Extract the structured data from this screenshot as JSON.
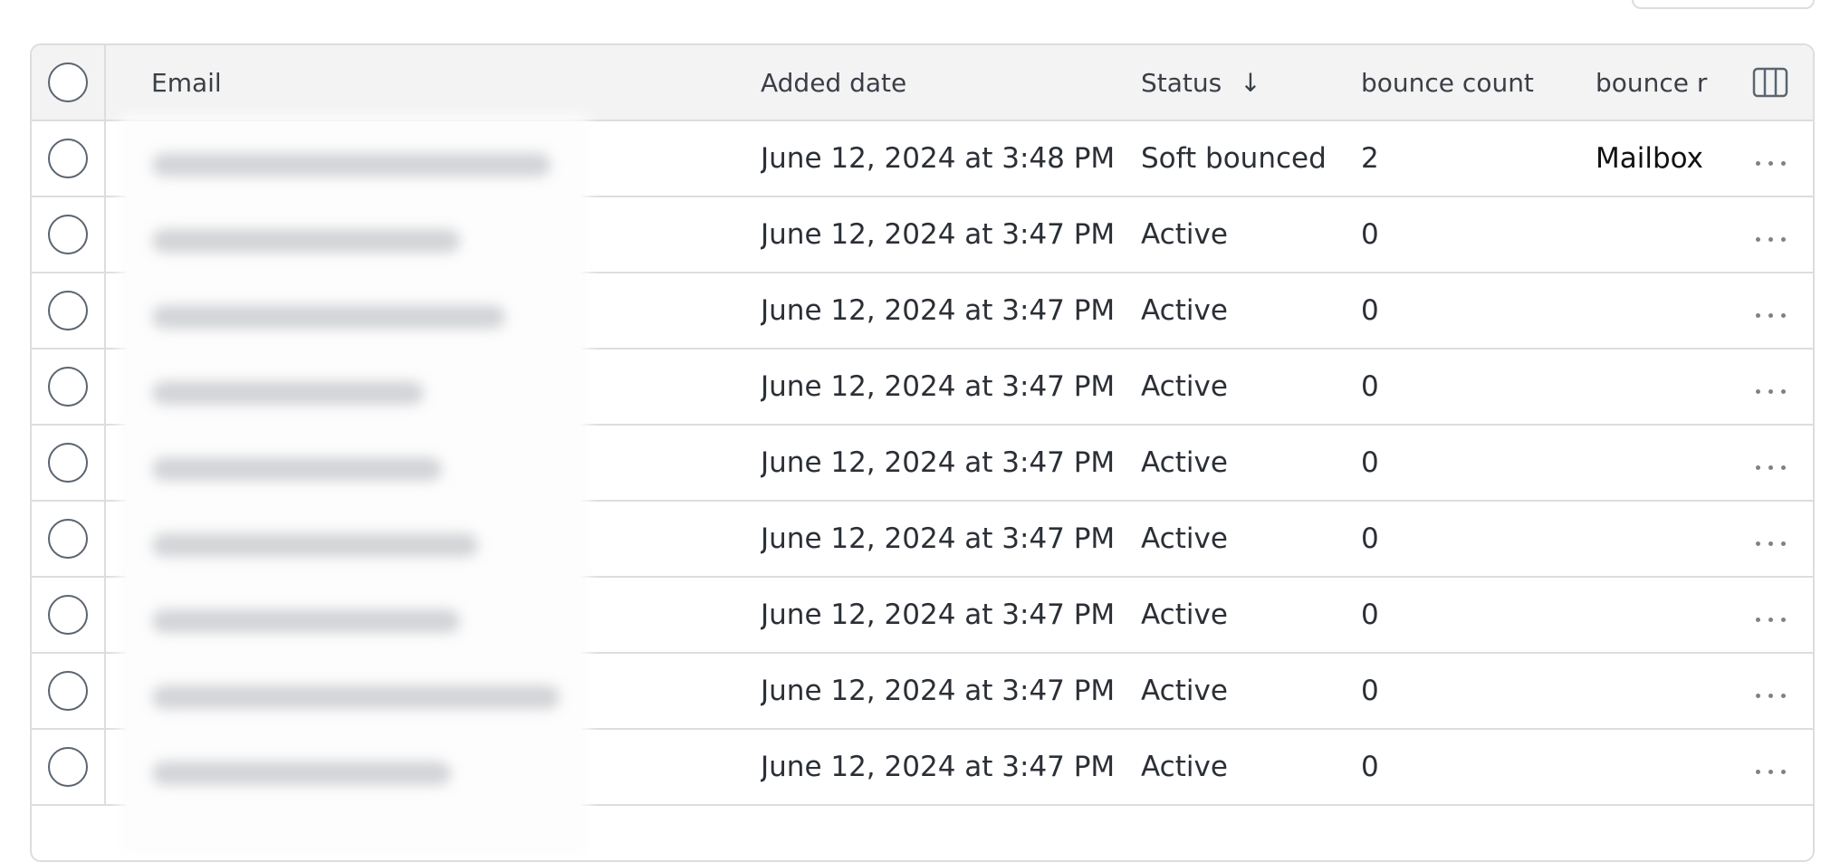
{
  "columns": {
    "email": "Email",
    "added_date": "Added date",
    "status": "Status",
    "status_sort": "↓",
    "bounce_count": "bounce count",
    "bounce_reason": "bounce r"
  },
  "icons": {
    "columns": "columns-icon",
    "row_actions": "more-horizontal-icon",
    "sort": "arrow-down-icon"
  },
  "rows": [
    {
      "email": "",
      "added_date": "June 12, 2024 at 3:48 PM",
      "status": "Soft bounced",
      "bounce_count": "2",
      "bounce_reason": "Mailbox"
    },
    {
      "email": "",
      "added_date": "June 12, 2024 at 3:47 PM",
      "status": "Active",
      "bounce_count": "0",
      "bounce_reason": ""
    },
    {
      "email": "",
      "added_date": "June 12, 2024 at 3:47 PM",
      "status": "Active",
      "bounce_count": "0",
      "bounce_reason": ""
    },
    {
      "email": "",
      "added_date": "June 12, 2024 at 3:47 PM",
      "status": "Active",
      "bounce_count": "0",
      "bounce_reason": ""
    },
    {
      "email": "",
      "added_date": "June 12, 2024 at 3:47 PM",
      "status": "Active",
      "bounce_count": "0",
      "bounce_reason": ""
    },
    {
      "email": "",
      "added_date": "June 12, 2024 at 3:47 PM",
      "status": "Active",
      "bounce_count": "0",
      "bounce_reason": ""
    },
    {
      "email": "",
      "added_date": "June 12, 2024 at 3:47 PM",
      "status": "Active",
      "bounce_count": "0",
      "bounce_reason": ""
    },
    {
      "email": "",
      "added_date": "June 12, 2024 at 3:47 PM",
      "status": "Active",
      "bounce_count": "0",
      "bounce_reason": ""
    },
    {
      "email": "",
      "added_date": "June 12, 2024 at 3:47 PM",
      "status": "Active",
      "bounce_count": "0",
      "bounce_reason": ""
    }
  ]
}
